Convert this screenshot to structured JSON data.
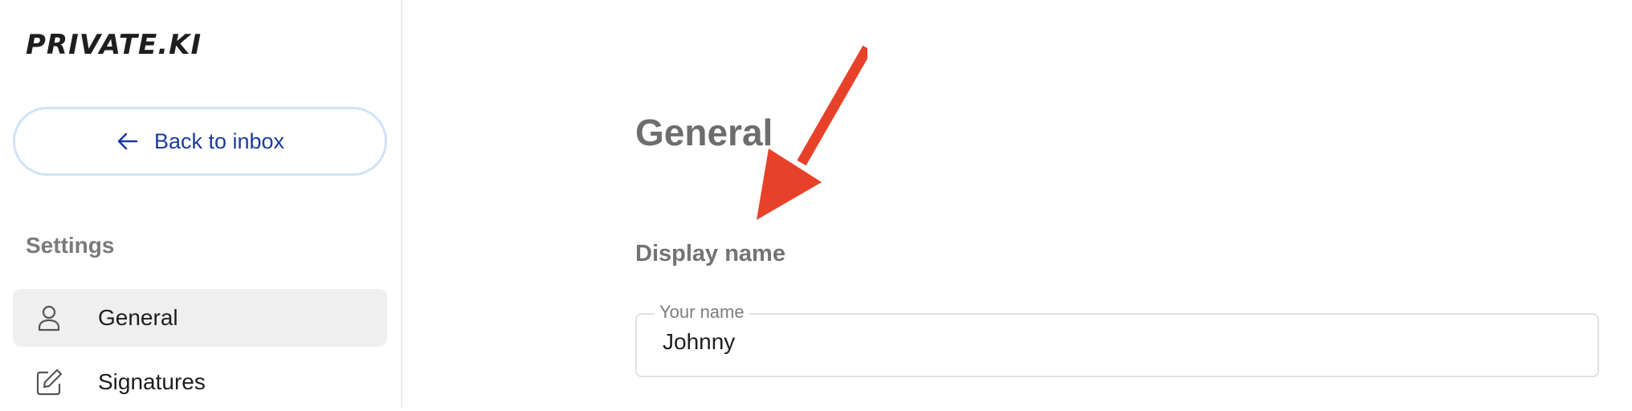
{
  "brand": {
    "logo_text": "PRIVATE.KI"
  },
  "sidebar": {
    "back_button": {
      "label": "Back to inbox",
      "icon": "arrow-left-icon"
    },
    "section_heading": "Settings",
    "items": [
      {
        "label": "General",
        "icon": "user-icon",
        "active": true
      },
      {
        "label": "Signatures",
        "icon": "edit-icon",
        "active": false
      }
    ]
  },
  "main": {
    "title": "General",
    "display_name": {
      "heading": "Display name",
      "field_label": "Your name",
      "value": "Johnny"
    }
  },
  "colors": {
    "accent": "#1b3a9e",
    "button_border": "#d2e2f8",
    "active_nav_bg": "#efefef",
    "annotation_arrow": "#e8412a"
  }
}
